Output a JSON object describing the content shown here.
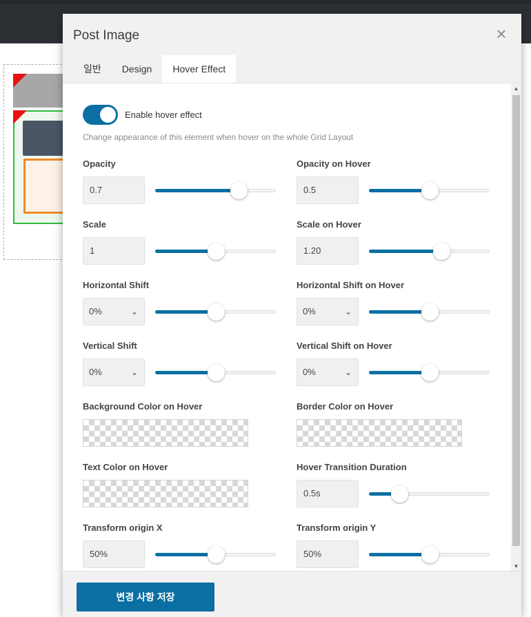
{
  "modal": {
    "title": "Post Image",
    "close_icon": "close-icon",
    "tabs": [
      {
        "label": "일반",
        "active": false
      },
      {
        "label": "Design",
        "active": false
      },
      {
        "label": "Hover Effect",
        "active": true
      }
    ],
    "enable_hover": {
      "label": "Enable hover effect",
      "on": true
    },
    "hint": "Change appearance of this element when hover on the whole Grid Layout",
    "fields": {
      "opacity": {
        "label": "Opacity",
        "value": "0.7",
        "slider": 0.69
      },
      "opacity_hover": {
        "label": "Opacity on Hover",
        "value": "0.5",
        "slider": 0.5
      },
      "scale": {
        "label": "Scale",
        "value": "1",
        "slider": 0.5
      },
      "scale_hover": {
        "label": "Scale on Hover",
        "value": "1.20",
        "slider": 0.6
      },
      "hshift": {
        "label": "Horizontal Shift",
        "value": "0%",
        "slider": 0.5
      },
      "hshift_hover": {
        "label": "Horizontal Shift on Hover",
        "value": "0%",
        "slider": 0.5
      },
      "vshift": {
        "label": "Vertical Shift",
        "value": "0%",
        "slider": 0.5
      },
      "vshift_hover": {
        "label": "Vertical Shift on Hover",
        "value": "0%",
        "slider": 0.5
      },
      "bg_color_hover": {
        "label": "Background Color on Hover"
      },
      "border_color_hover": {
        "label": "Border Color on Hover"
      },
      "text_color_hover": {
        "label": "Text Color on Hover"
      },
      "transition": {
        "label": "Hover Transition Duration",
        "value": "0.5s",
        "slider": 0.25
      },
      "origin_x": {
        "label": "Transform origin X",
        "value": "50%",
        "slider": 0.5
      },
      "origin_y": {
        "label": "Transform origin Y",
        "value": "50%",
        "slider": 0.5
      }
    },
    "save_label": "변경 사항 저장"
  },
  "colors": {
    "accent": "#0b6fa3",
    "panel_bg": "#f1f1f1"
  }
}
